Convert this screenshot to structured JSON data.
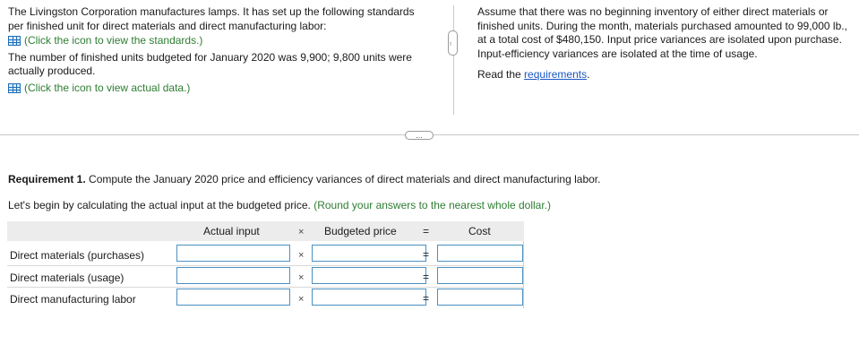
{
  "left_panel": {
    "intro": "The Livingston Corporation manufactures lamps. It has set up the following standards per finished unit for direct materials and direct manufacturing labor:",
    "standards_link": "(Click the icon to view the standards.)",
    "units_text": "The number of finished units budgeted for January 2020 was 9,900; 9,800 units were actually produced.",
    "actual_link": "(Click the icon to view actual data.)"
  },
  "right_panel": {
    "assumption": "Assume that there was no beginning inventory of either direct materials or finished units. During the month, materials purchased amounted to 99,000 lb., at a total cost of $480,150. Input price variances are isolated upon purchase. Input-efficiency variances are isolated at the time of usage.",
    "read_prefix": "Read the ",
    "requirements_link": "requirements",
    "read_suffix": "."
  },
  "handles": {
    "vertical": "...",
    "horizontal": "..."
  },
  "requirement": {
    "label": "Requirement 1.",
    "text": " Compute the January 2020 price and efficiency variances of direct materials and direct manufacturing labor.",
    "instruction": "Let's begin by calculating the actual input at the budgeted price.",
    "hint": "(Round your answers to the nearest whole dollar.)"
  },
  "table": {
    "headers": {
      "actual_input": "Actual input",
      "times": "×",
      "budgeted_price": "Budgeted price",
      "equals": "=",
      "cost": "Cost"
    },
    "rows": [
      {
        "label": "Direct materials (purchases)",
        "actual_input": "",
        "budgeted_price": "",
        "cost": ""
      },
      {
        "label": "Direct materials (usage)",
        "actual_input": "",
        "budgeted_price": "",
        "cost": ""
      },
      {
        "label": "Direct manufacturing labor",
        "actual_input": "",
        "budgeted_price": "",
        "cost": ""
      }
    ],
    "times_symbol": "×",
    "equals_symbol": "="
  },
  "colors": {
    "hint_green": "#2e7d32",
    "link_blue": "#1a57c4",
    "input_border": "#4a90c2",
    "header_bg": "#ececec"
  }
}
